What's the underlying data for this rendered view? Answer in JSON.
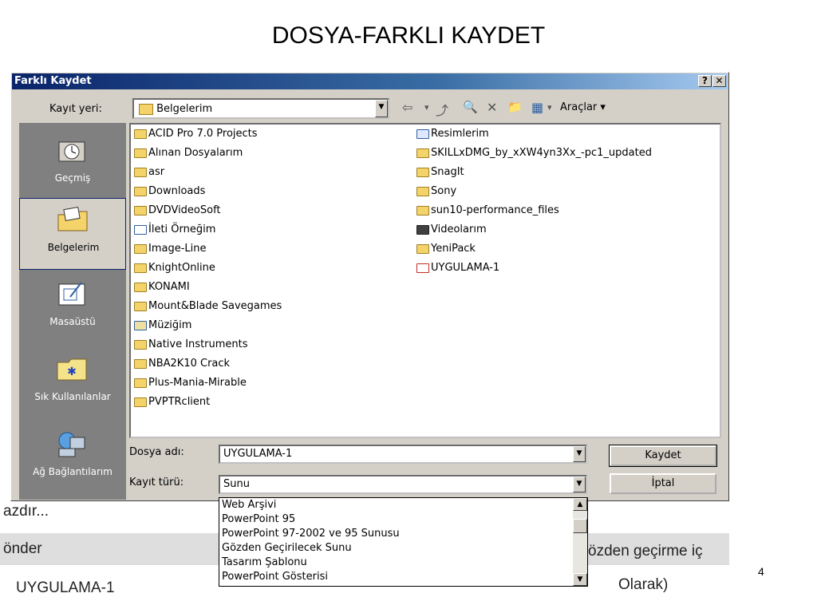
{
  "slide": {
    "title": "DOSYA-FARKLI KAYDET",
    "page_number": "4"
  },
  "dialog": {
    "title": "Farklı Kaydet",
    "help_button": "?",
    "close_button": "✕",
    "save_in_label": "Kayıt yeri:",
    "save_in_value": "Belgelerim",
    "toolbar": {
      "back": "⇦",
      "up": "⤴",
      "search": "🔍",
      "delete": "✕",
      "new_folder": "📁",
      "views": "▦",
      "tools_label": "Araçlar"
    },
    "places": [
      {
        "label": "Geçmiş",
        "icon": "history-icon"
      },
      {
        "label": "Belgelerim",
        "icon": "my-documents-icon"
      },
      {
        "label": "Masaüstü",
        "icon": "desktop-icon"
      },
      {
        "label": "Sık Kullanılanlar",
        "icon": "favorites-icon"
      },
      {
        "label": "Ağ Bağlantılarım",
        "icon": "network-icon"
      }
    ],
    "files_left": [
      {
        "name": "ACID Pro 7.0 Projects",
        "icon": "folder"
      },
      {
        "name": "Alınan Dosyalarım",
        "icon": "folder"
      },
      {
        "name": "asr",
        "icon": "folder"
      },
      {
        "name": "Downloads",
        "icon": "folder"
      },
      {
        "name": "DVDVideoSoft",
        "icon": "folder"
      },
      {
        "name": "İleti Örneğim",
        "icon": "doc"
      },
      {
        "name": "Image-Line",
        "icon": "folder"
      },
      {
        "name": "KnightOnline",
        "icon": "folder"
      },
      {
        "name": "KONAMI",
        "icon": "folder"
      },
      {
        "name": "Mount&Blade Savegames",
        "icon": "folder"
      },
      {
        "name": "Müziğim",
        "icon": "music"
      },
      {
        "name": "Native Instruments",
        "icon": "folder"
      },
      {
        "name": "NBA2K10 Crack",
        "icon": "folder"
      },
      {
        "name": "Plus-Mania-Mirable",
        "icon": "folder"
      },
      {
        "name": "PVPTRclient",
        "icon": "folder"
      }
    ],
    "files_right": [
      {
        "name": "Resimlerim",
        "icon": "img"
      },
      {
        "name": "SKILLxDMG_by_xXW4yn3Xx_-pc1_updated",
        "icon": "folder"
      },
      {
        "name": "SnagIt",
        "icon": "folder"
      },
      {
        "name": "Sony",
        "icon": "folder"
      },
      {
        "name": "sun10-performance_files",
        "icon": "folder"
      },
      {
        "name": "Videolarım",
        "icon": "film"
      },
      {
        "name": "YeniPack",
        "icon": "folder"
      },
      {
        "name": "UYGULAMA-1",
        "icon": "ppt"
      }
    ],
    "filename_label": "Dosya adı:",
    "filename_value": "UYGULAMA-1",
    "filetype_label": "Kayıt türü:",
    "filetype_value": "Sunu",
    "save_button": "Kaydet",
    "cancel_button": "İptal",
    "filetype_options": [
      "Web Arşivi",
      "PowerPoint 95",
      "PowerPoint 97-2002 ve 95 Sunusu",
      "Gözden Geçirilecek Sunu",
      "Tasarım Şablonu",
      "PowerPoint Gösterisi"
    ]
  },
  "background": {
    "print_text": "azdır...",
    "send_text": "önder",
    "review_text": "özden geçirme iç",
    "file_text": "UYGULAMA-1",
    "bottom_right_text": "Olarak)"
  }
}
